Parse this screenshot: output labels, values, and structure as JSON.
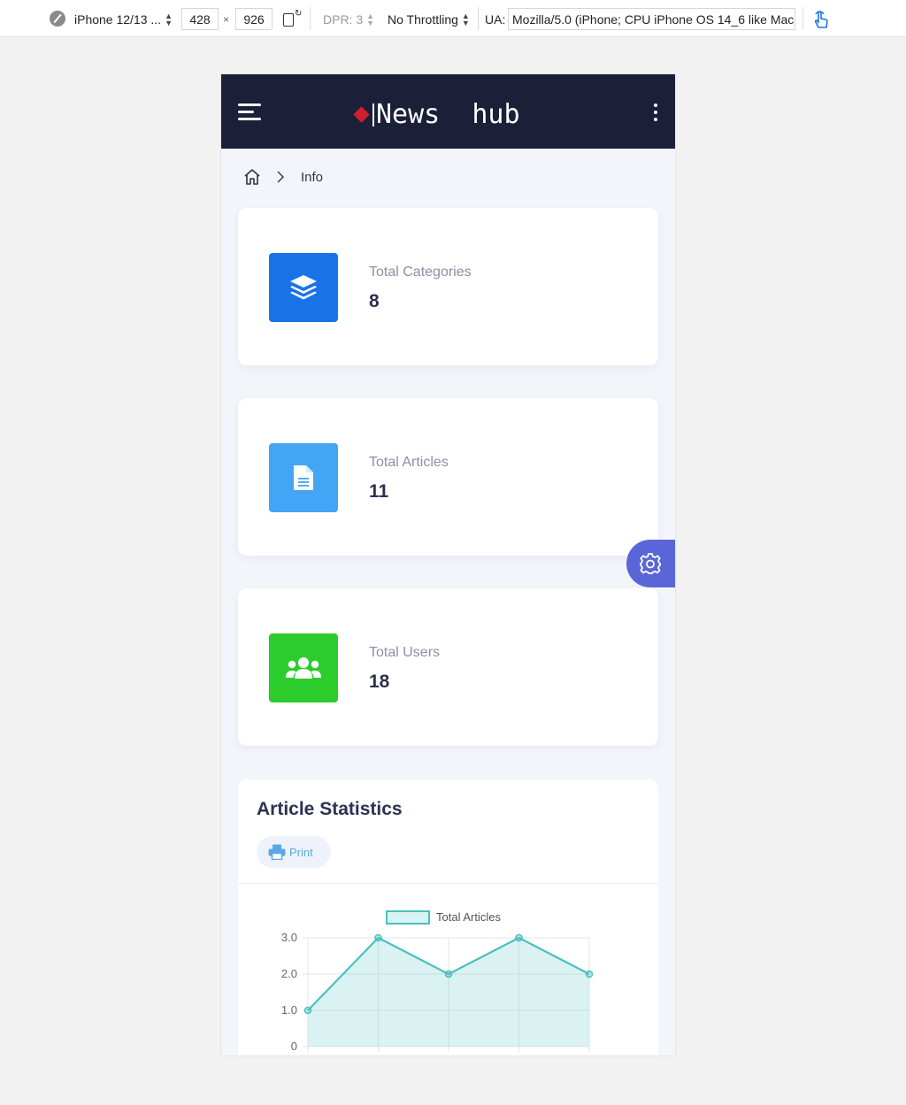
{
  "devtools": {
    "device": "iPhone 12/13 ...",
    "width": "428",
    "times": "×",
    "height": "926",
    "dpr": "DPR: 3",
    "throttling": "No Throttling",
    "ua_label": "UA:",
    "ua_value": "Mozilla/5.0 (iPhone; CPU iPhone OS 14_6 like Mac"
  },
  "navbar": {
    "brand": "News  hub"
  },
  "breadcrumb": {
    "current": "Info"
  },
  "cards": [
    {
      "label": "Total Categories",
      "value": "8",
      "color": "#1a72e8",
      "icon": "layers-icon"
    },
    {
      "label": "Total Articles",
      "value": "11",
      "color": "#42a5f5",
      "icon": "document-icon"
    },
    {
      "label": "Total Users",
      "value": "18",
      "color": "#2dcc2d",
      "icon": "users-icon"
    }
  ],
  "stats": {
    "title": "Article Statistics",
    "print_label": "Print"
  },
  "colors": {
    "navbar_bg": "#1b1f37",
    "accent": "#5a66d8",
    "line": "#4bc0c0"
  },
  "chart_data": {
    "type": "area",
    "series": [
      {
        "name": "Total Articles",
        "values": [
          1,
          3,
          2,
          3,
          2
        ]
      }
    ],
    "y_ticks": [
      "3.0",
      "2.0",
      "1.0",
      "0"
    ],
    "ylim": [
      0,
      3
    ],
    "grid": true,
    "legend": "top"
  }
}
